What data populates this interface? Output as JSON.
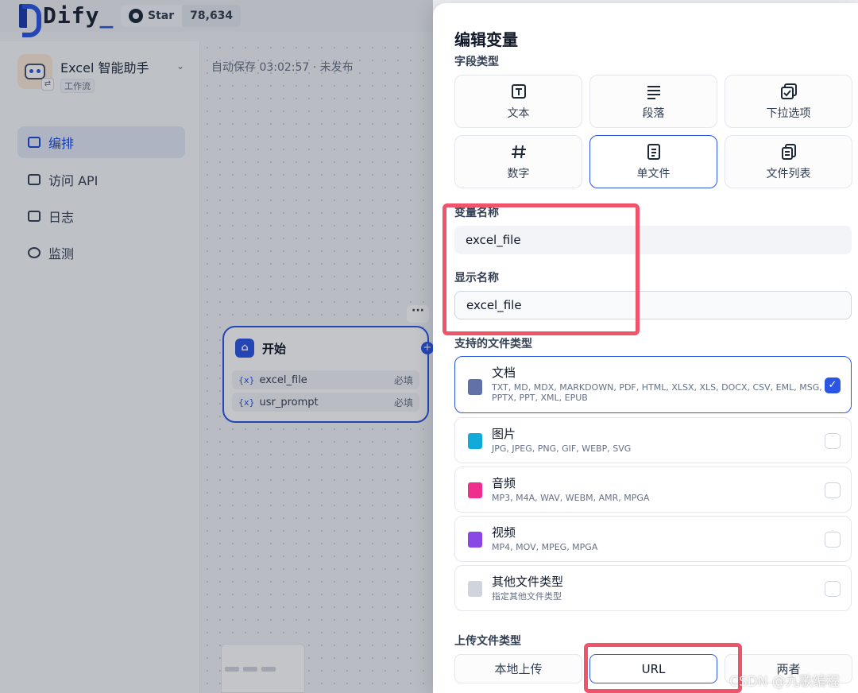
{
  "header": {
    "logo_text": "Dify",
    "github_star_label": "Star",
    "github_star_count": "78,634"
  },
  "sidebar": {
    "app_name": "Excel 智能助手",
    "app_type": "工作流",
    "items": [
      {
        "label": "编排",
        "active": true
      },
      {
        "label": "访问 API",
        "active": false
      },
      {
        "label": "日志",
        "active": false
      },
      {
        "label": "监测",
        "active": false
      }
    ]
  },
  "canvas": {
    "autosave_status": "自动保存 03:02:57 · 未发布",
    "start_node": {
      "title": "开始",
      "variables": [
        {
          "prefix": "{x}",
          "name": "excel_file",
          "required": "必填"
        },
        {
          "prefix": "{x}",
          "name": "usr_prompt",
          "required": "必填"
        }
      ]
    }
  },
  "dialog": {
    "title": "编辑变量",
    "field_type_label": "字段类型",
    "field_types": [
      {
        "label": "文本",
        "icon": "text-input-icon",
        "selected": false
      },
      {
        "label": "段落",
        "icon": "paragraph-icon",
        "selected": false
      },
      {
        "label": "下拉选项",
        "icon": "select-options-icon",
        "selected": false
      },
      {
        "label": "数字",
        "icon": "hash-icon",
        "selected": false
      },
      {
        "label": "单文件",
        "icon": "single-file-icon",
        "selected": true
      },
      {
        "label": "文件列表",
        "icon": "file-list-icon",
        "selected": false
      }
    ],
    "variable_name_label": "变量名称",
    "variable_name_value": "excel_file",
    "display_name_label": "显示名称",
    "display_name_value": "excel_file",
    "supported_types_label": "支持的文件类型",
    "file_categories": [
      {
        "name": "文档",
        "desc": "TXT, MD, MDX, MARKDOWN, PDF, HTML, XLSX, XLS, DOCX, CSV, EML, MSG, PPTX, PPT, XML, EPUB",
        "checked": true,
        "color": "#6172a8"
      },
      {
        "name": "图片",
        "desc": "JPG, JPEG, PNG, GIF, WEBP, SVG",
        "checked": false,
        "color": "#11aadb"
      },
      {
        "name": "音频",
        "desc": "MP3, M4A, WAV, WEBM, AMR, MPGA",
        "checked": false,
        "color": "#ee2f8e"
      },
      {
        "name": "视频",
        "desc": "MP4, MOV, MPEG, MPGA",
        "checked": false,
        "color": "#8a47e6"
      },
      {
        "name": "其他文件类型",
        "desc": "指定其他文件类型",
        "checked": false,
        "color": "#d0d5dd"
      }
    ],
    "upload_type_label": "上传文件类型",
    "upload_types": [
      {
        "label": "本地上传",
        "selected": false
      },
      {
        "label": "URL",
        "selected": true
      },
      {
        "label": "两者",
        "selected": false
      }
    ]
  },
  "watermark": "CSDN @九歌编程",
  "colors": {
    "accent": "#2b56e5",
    "highlight": "#f0546b"
  }
}
